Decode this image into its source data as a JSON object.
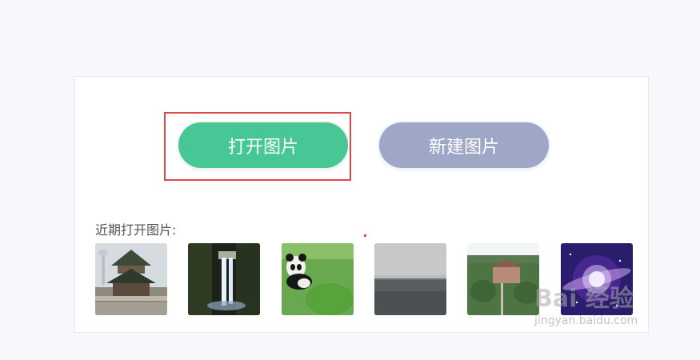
{
  "buttons": {
    "open_label": "打开图片",
    "new_label": "新建图片"
  },
  "recent": {
    "label": "近期打开图片:",
    "thumbnails": [
      {
        "name": "pagoda-photo"
      },
      {
        "name": "waterfall-photo"
      },
      {
        "name": "panda-photo"
      },
      {
        "name": "lake-photo"
      },
      {
        "name": "castle-photo"
      },
      {
        "name": "galaxy-photo"
      }
    ]
  },
  "watermark": {
    "logo": "Bai 经验",
    "url": "jingyan.baidu.com"
  },
  "colors": {
    "open_button": "#47c795",
    "new_button": "#9ea8c6",
    "highlight": "#e04848",
    "page_bg": "#f7f8fc"
  }
}
